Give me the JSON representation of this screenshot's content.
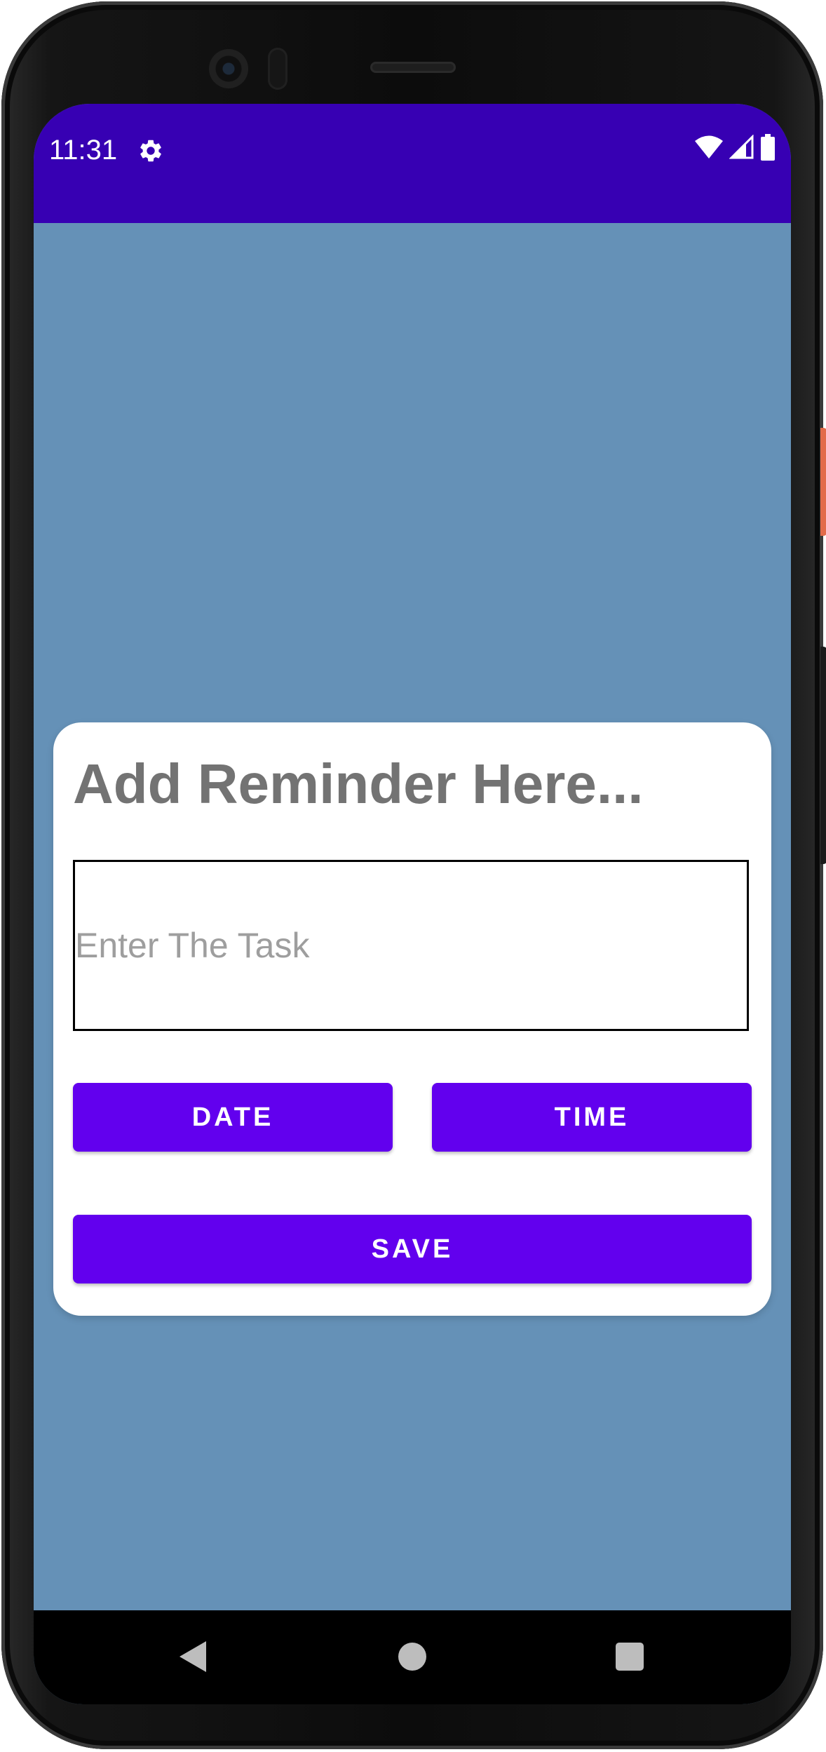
{
  "status_bar": {
    "time": "11:31",
    "color": "#3700b3",
    "icons": [
      "settings-gear-icon",
      "wifi-icon",
      "cellular-signal-icon",
      "battery-icon"
    ]
  },
  "background_color": "#6591b7",
  "card": {
    "title": "Add Reminder Here...",
    "task_input": {
      "value": "",
      "placeholder": "Enter The Task"
    },
    "date_button_label": "DATE",
    "time_button_label": "TIME",
    "save_button_label": "SAVE",
    "button_color": "#6200ee"
  },
  "nav_bar": {
    "icons": [
      "back-icon",
      "home-icon",
      "recent-apps-icon"
    ]
  }
}
